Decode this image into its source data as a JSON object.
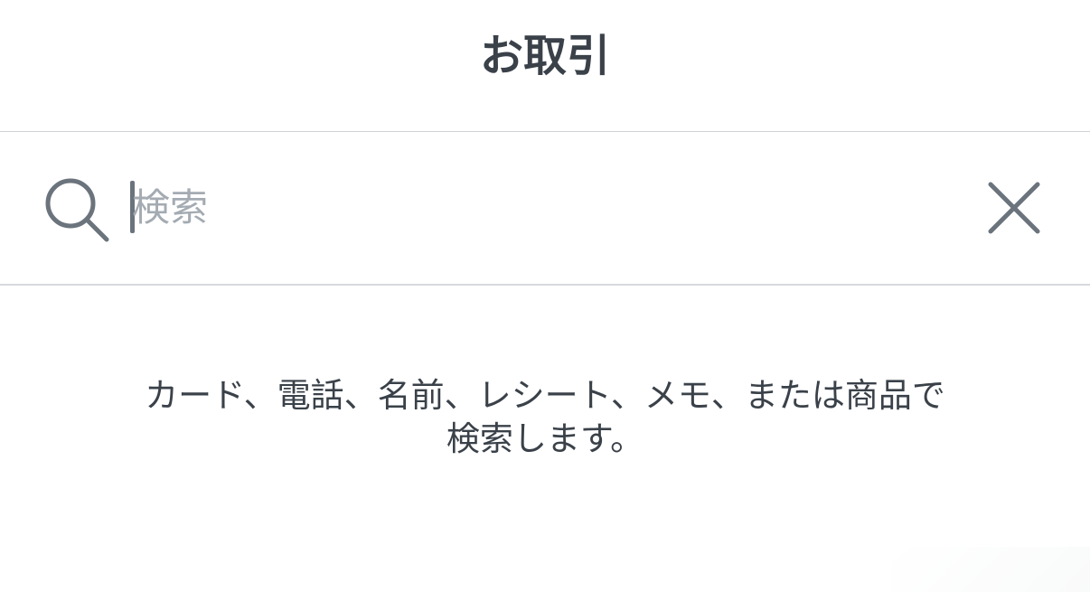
{
  "header": {
    "title": "お取引"
  },
  "search": {
    "placeholder": "検索",
    "value": "",
    "icon": "search-icon",
    "clear_icon": "close-icon"
  },
  "hint": {
    "line1": "カード、電話、名前、レシート、メモ、または商品で",
    "line2": "検索します。"
  },
  "colors": {
    "text": "#3a4149",
    "placeholder": "#a4abb2",
    "icon": "#6b747c",
    "divider": "#d6d9dc"
  }
}
